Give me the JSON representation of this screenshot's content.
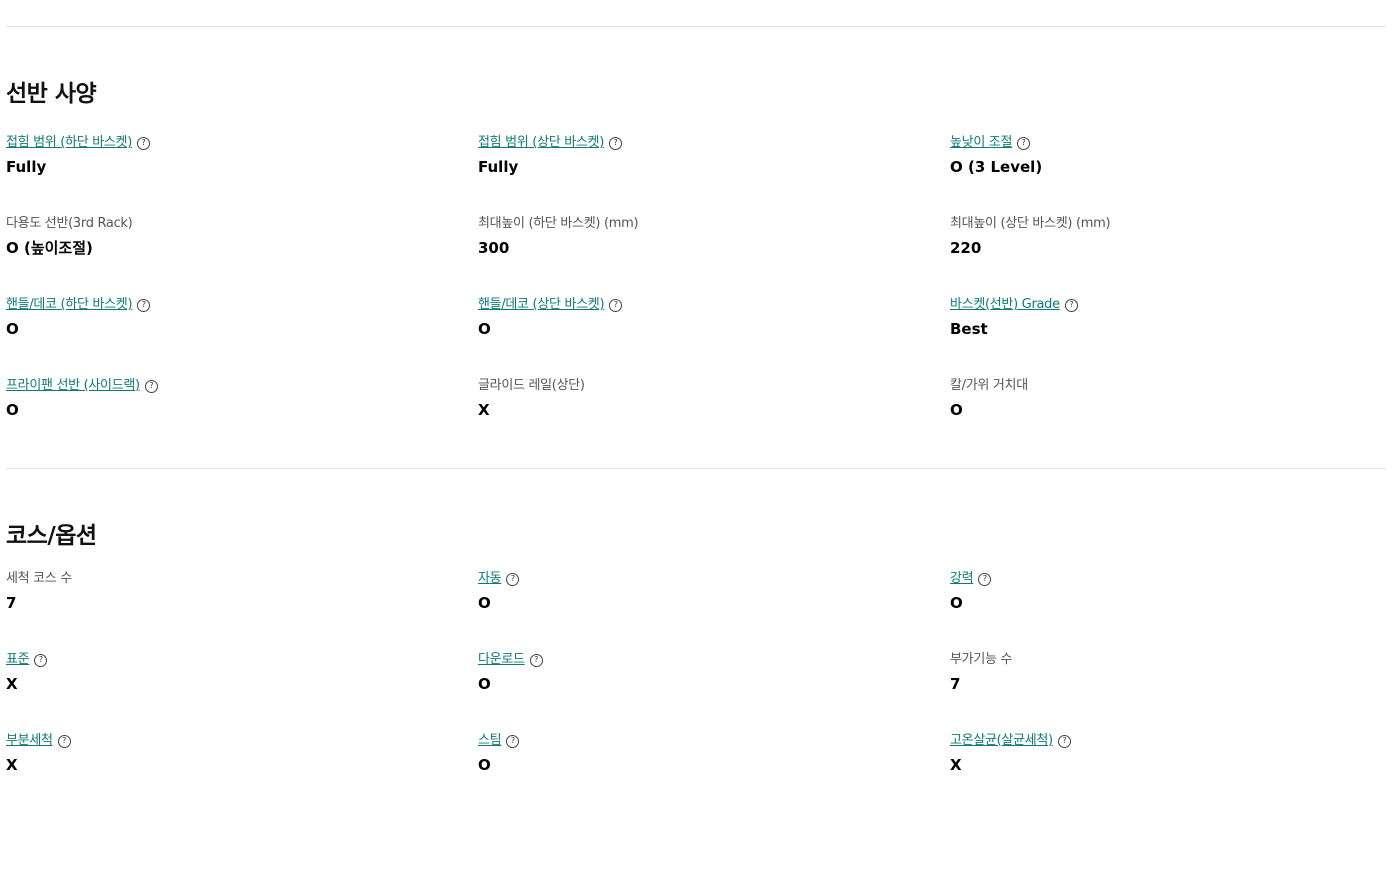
{
  "sections": [
    {
      "title": "선반 사양",
      "items": [
        {
          "label": "접힘 범위 (하단 바스켓)",
          "link": true,
          "value": "Fully"
        },
        {
          "label": "접힘 범위 (상단 바스켓)",
          "link": true,
          "value": "Fully"
        },
        {
          "label": "높낮이 조절",
          "link": true,
          "value": "O (3 Level)"
        },
        {
          "label": "다용도 선반(3rd Rack)",
          "link": false,
          "value": "O (높이조절)"
        },
        {
          "label": "최대높이 (하단 바스켓) (mm)",
          "link": false,
          "value": "300"
        },
        {
          "label": "최대높이 (상단 바스켓) (mm)",
          "link": false,
          "value": "220"
        },
        {
          "label": "핸들/데코 (하단 바스켓)",
          "link": true,
          "value": "O"
        },
        {
          "label": "핸들/데코 (상단 바스켓)",
          "link": true,
          "value": "O"
        },
        {
          "label": "바스켓(선반) Grade",
          "link": true,
          "value": "Best"
        },
        {
          "label": "프라이팬 선반 (사이드랙)",
          "link": true,
          "value": "O"
        },
        {
          "label": "글라이드 레일(상단)",
          "link": false,
          "value": "X"
        },
        {
          "label": "칼/가위 거치대",
          "link": false,
          "value": "O"
        }
      ]
    },
    {
      "title": "코스/옵션",
      "items": [
        {
          "label": "세척 코스 수",
          "link": false,
          "value": "7"
        },
        {
          "label": "자동",
          "link": true,
          "value": "O"
        },
        {
          "label": "강력",
          "link": true,
          "value": "O"
        },
        {
          "label": "표준",
          "link": true,
          "value": "X"
        },
        {
          "label": "다운로드",
          "link": true,
          "value": "O"
        },
        {
          "label": "부가기능 수",
          "link": false,
          "value": "7"
        },
        {
          "label": "부분세척",
          "link": true,
          "value": "X"
        },
        {
          "label": "스팀",
          "link": true,
          "value": "O"
        },
        {
          "label": "고온살균(살균세척)",
          "link": true,
          "value": "X"
        }
      ]
    }
  ],
  "help_icon_glyph": "?",
  "colors": {
    "link": "#0f7a78",
    "divider": "#e2e2e2"
  }
}
